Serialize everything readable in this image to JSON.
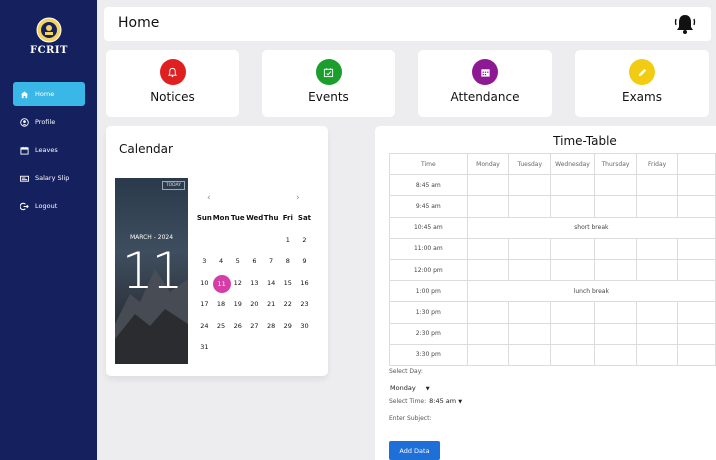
{
  "brand": {
    "name": "FCRIT"
  },
  "sidebar": {
    "items": [
      {
        "label": "Home",
        "icon": "home-icon",
        "active": true
      },
      {
        "label": "Profile",
        "icon": "profile-icon",
        "active": false
      },
      {
        "label": "Leaves",
        "icon": "calendar-icon",
        "active": false
      },
      {
        "label": "Salary Slip",
        "icon": "salary-slip-icon",
        "active": false
      },
      {
        "label": "Logout",
        "icon": "logout-icon",
        "active": false
      }
    ]
  },
  "header": {
    "title": "Home",
    "bell_icon": "bell-icon"
  },
  "cards": [
    {
      "label": "Notices",
      "icon": "bell-icon",
      "color": "#e02020"
    },
    {
      "label": "Events",
      "icon": "calendar-check-icon",
      "color": "#1b9e2c"
    },
    {
      "label": "Attendance",
      "icon": "calendar-grid-icon",
      "color": "#8e1a93"
    },
    {
      "label": "Exams",
      "icon": "pencil-icon",
      "color": "#f2cc13"
    }
  ],
  "calendar": {
    "title": "Calendar",
    "today_label": "TODAY",
    "month_label": "MARCH - 2024",
    "big_day": "11",
    "prev_icon": "chevron-left-icon",
    "next_icon": "chevron-right-icon",
    "weekdays": [
      "Sun",
      "Mon",
      "Tue",
      "Wed",
      "Thu",
      "Fri",
      "Sat"
    ],
    "weeks": [
      [
        "",
        "",
        "",
        "",
        "",
        "1",
        "2"
      ],
      [
        "3",
        "4",
        "5",
        "6",
        "7",
        "8",
        "9"
      ],
      [
        "10",
        "11",
        "12",
        "13",
        "14",
        "15",
        "16"
      ],
      [
        "17",
        "18",
        "19",
        "20",
        "21",
        "22",
        "23"
      ],
      [
        "24",
        "25",
        "26",
        "27",
        "28",
        "29",
        "30"
      ],
      [
        "31",
        "",
        "",
        "",
        "",
        "",
        ""
      ]
    ],
    "selected_day": "11",
    "accent": "#d53ea6"
  },
  "timetable": {
    "title": "Time-Table",
    "headers": [
      "Time",
      "Monday",
      "Tuesday",
      "Wednesday",
      "Thursday",
      "Friday"
    ],
    "rows": [
      {
        "time": "8:45 am"
      },
      {
        "time": "9:45 am"
      },
      {
        "time": "10:45 am",
        "break": "short break"
      },
      {
        "time": "11:00 am"
      },
      {
        "time": "12:00 pm"
      },
      {
        "time": "1:00 pm",
        "break": "lunch break"
      },
      {
        "time": "1:30 pm"
      },
      {
        "time": "2:30 pm"
      },
      {
        "time": "3:30 pm"
      }
    ]
  },
  "form": {
    "select_day_label": "Select Day:",
    "day_value": "Monday",
    "select_time_label": "Select Time:",
    "time_value": "8:45 am",
    "subject_label": "Enter Subject:",
    "add_button": "Add Data"
  },
  "colors": {
    "sidebar": "#15215f",
    "active_nav": "#39b8e8",
    "button": "#1f6fd8"
  }
}
